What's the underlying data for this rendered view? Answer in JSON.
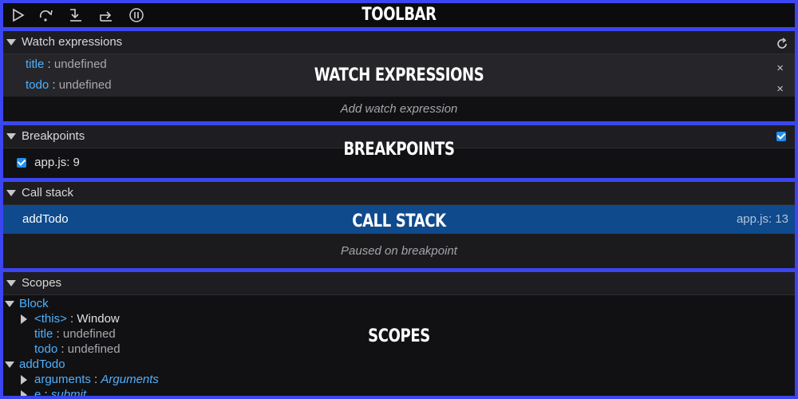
{
  "overlays": {
    "toolbar": "TOOLBAR",
    "watch": "WATCH EXPRESSIONS",
    "breakpoints": "BREAKPOINTS",
    "callstack": "CALL STACK",
    "scopes": "SCOPES"
  },
  "toolbar": {
    "buttons": [
      "play-icon",
      "step-over-icon",
      "step-into-icon",
      "step-out-icon",
      "pause-icon"
    ]
  },
  "watch": {
    "title": "Watch expressions",
    "items": [
      {
        "key": "title",
        "value": "undefined"
      },
      {
        "key": "todo",
        "value": "undefined"
      }
    ],
    "add_placeholder": "Add watch expression",
    "separator": " : ",
    "remove_glyph": "×"
  },
  "breakpoints": {
    "title": "Breakpoints",
    "items": [
      {
        "label": "app.js: 9",
        "checked": true
      }
    ]
  },
  "callstack": {
    "title": "Call stack",
    "frames": [
      {
        "name": "addTodo",
        "location": "app.js: 13"
      }
    ],
    "status": "Paused on breakpoint"
  },
  "scopes": {
    "title": "Scopes",
    "tree": [
      {
        "label": "Block",
        "expanded": true,
        "children": [
          {
            "key": "<this>",
            "value": "Window",
            "expandable": true
          },
          {
            "key": "title",
            "value": "undefined",
            "expandable": false
          },
          {
            "key": "todo",
            "value": "undefined",
            "expandable": false
          }
        ]
      },
      {
        "label": "addTodo",
        "expanded": true,
        "children": [
          {
            "key": "arguments",
            "value": "Arguments",
            "expandable": true
          },
          {
            "key": "e",
            "value": "submit",
            "expandable": true
          }
        ]
      }
    ]
  },
  "colors": {
    "frame_border": "#3b46f0",
    "key_blue": "#4fb1ff",
    "selected_frame": "#0e4a8c",
    "checkbox": "#1f8ff0"
  }
}
